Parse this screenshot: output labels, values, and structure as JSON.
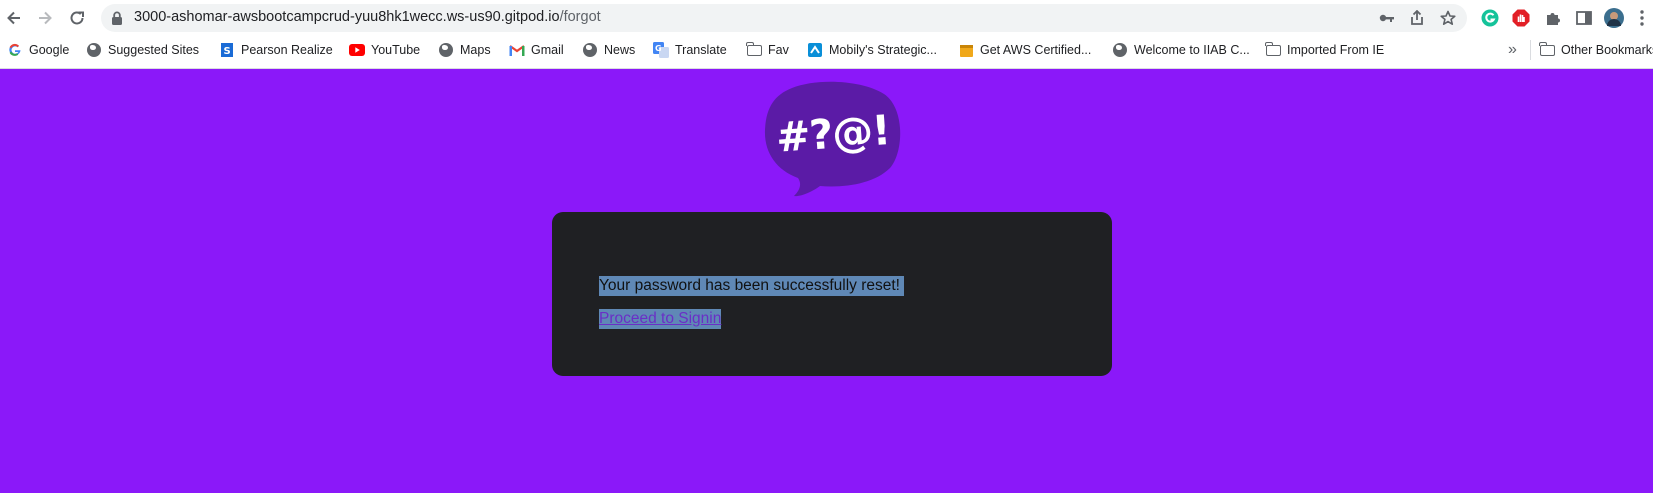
{
  "browser": {
    "url_host": "3000-ashomar-awsbootcampcrud-yuu8hk1wecc.ws-us90.gitpod.io",
    "url_path": "/forgot",
    "bookmarks": [
      {
        "label": "Google",
        "icon": "google-g-icon"
      },
      {
        "label": "Suggested Sites",
        "icon": "globe-icon"
      },
      {
        "label": "Pearson Realize",
        "icon": "pearson-icon"
      },
      {
        "label": "YouTube",
        "icon": "youtube-icon"
      },
      {
        "label": "Maps",
        "icon": "globe-icon"
      },
      {
        "label": "Gmail",
        "icon": "gmail-icon"
      },
      {
        "label": "News",
        "icon": "globe-icon"
      },
      {
        "label": "Translate",
        "icon": "translate-icon"
      },
      {
        "label": "Fav",
        "icon": "folder-icon"
      },
      {
        "label": "Mobily's Strategic...",
        "icon": "mobily-icon"
      },
      {
        "label": "Get AWS Certified...",
        "icon": "aws-box-icon"
      },
      {
        "label": "Welcome to IIAB C...",
        "icon": "globe-icon"
      },
      {
        "label": "Imported From IE",
        "icon": "folder-icon"
      }
    ],
    "overflow_label": "»",
    "other_bookmarks_label": "Other Bookmarks"
  },
  "page": {
    "logo_text": "#?@!",
    "message": "Your password has been successfully reset!",
    "proceed_link": "Proceed to Signin"
  },
  "colors": {
    "background": "#8b18f9",
    "card": "#1f2023",
    "logo_bubble": "#5b1ba6",
    "selection": "#5f88b6"
  }
}
